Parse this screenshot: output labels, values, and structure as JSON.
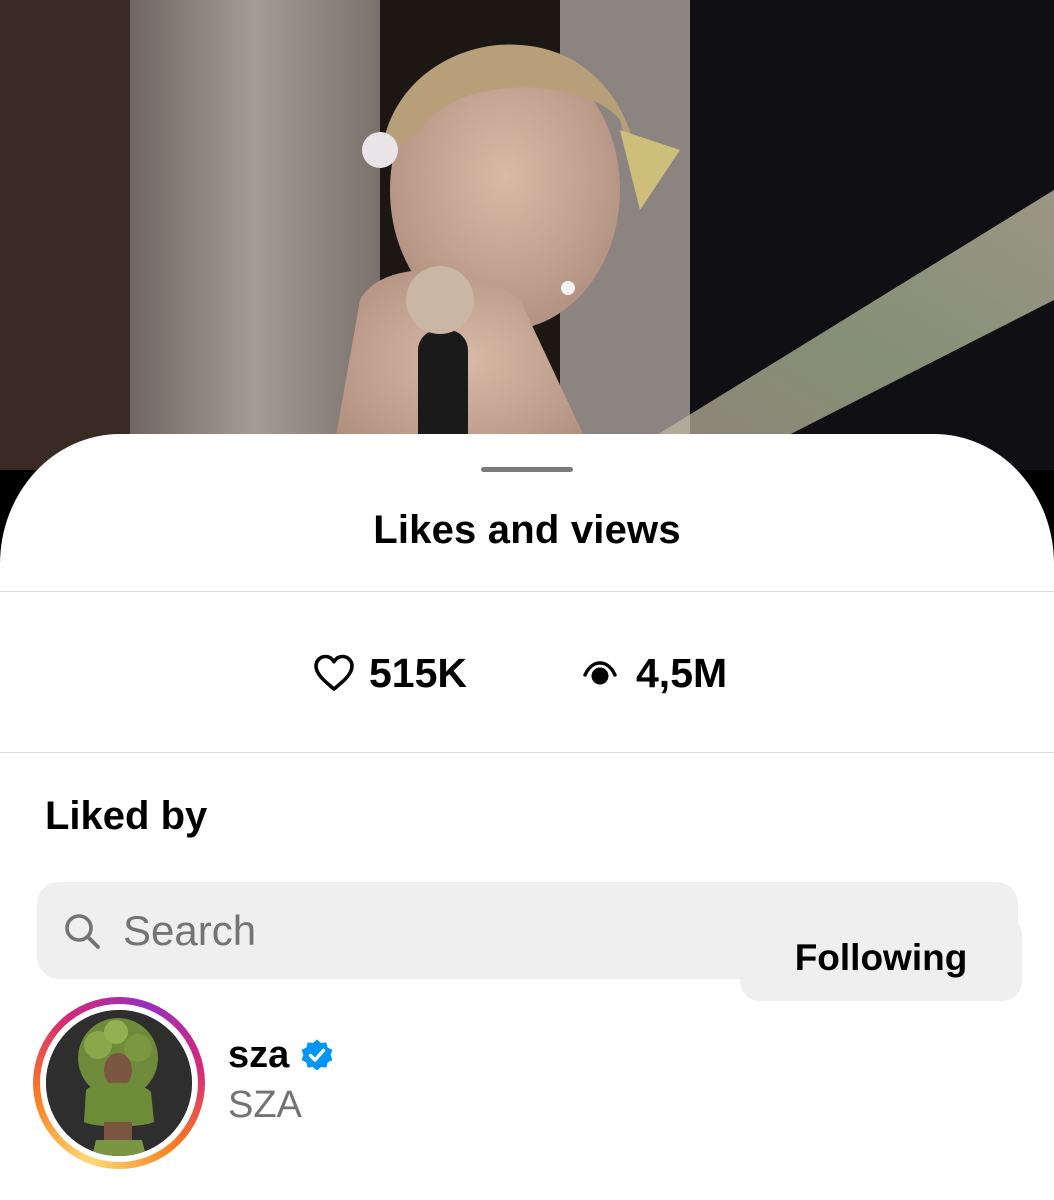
{
  "sheet": {
    "title": "Likes and views"
  },
  "stats": {
    "likes": "515K",
    "views": "4,5M",
    "likes_icon": "heart-outline-icon",
    "views_icon": "eye-icon"
  },
  "liked_by": {
    "heading": "Liked by",
    "search_placeholder": "Search",
    "search_icon": "search-icon"
  },
  "users": [
    {
      "username": "sza",
      "full_name": "SZA",
      "verified": true,
      "button_label": "Following"
    }
  ],
  "colors": {
    "verified_blue": "#0095f6",
    "button_bg": "#efefef",
    "secondary_text": "#737373"
  }
}
